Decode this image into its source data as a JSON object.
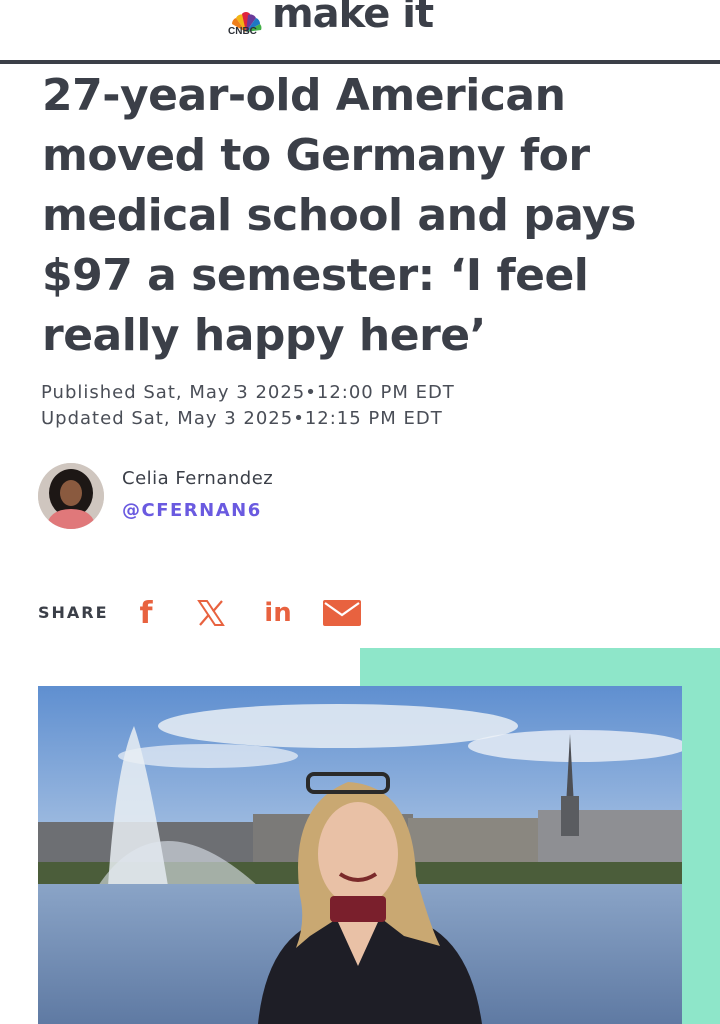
{
  "header": {
    "network": "CNBC",
    "brand": "make it"
  },
  "article": {
    "headline": "27-year-old American moved to Germany for medical school and pays $97 a semester: ‘I feel really happy here’",
    "published": "Published Sat, May 3 2025•12:00 PM EDT",
    "updated": "Updated Sat, May 3 2025•12:15 PM EDT"
  },
  "author": {
    "name": "Celia Fernandez",
    "handle": "@CFERNAN6"
  },
  "share": {
    "label": "SHARE",
    "facebook_glyph": "f",
    "linkedin_glyph": "in",
    "icons": [
      "facebook-icon",
      "x-icon",
      "linkedin-icon",
      "email-icon"
    ]
  },
  "colors": {
    "text": "#3b3f48",
    "accent": "#e8623f",
    "handle": "#6a5ae0",
    "mint": "#8ee6c9"
  }
}
